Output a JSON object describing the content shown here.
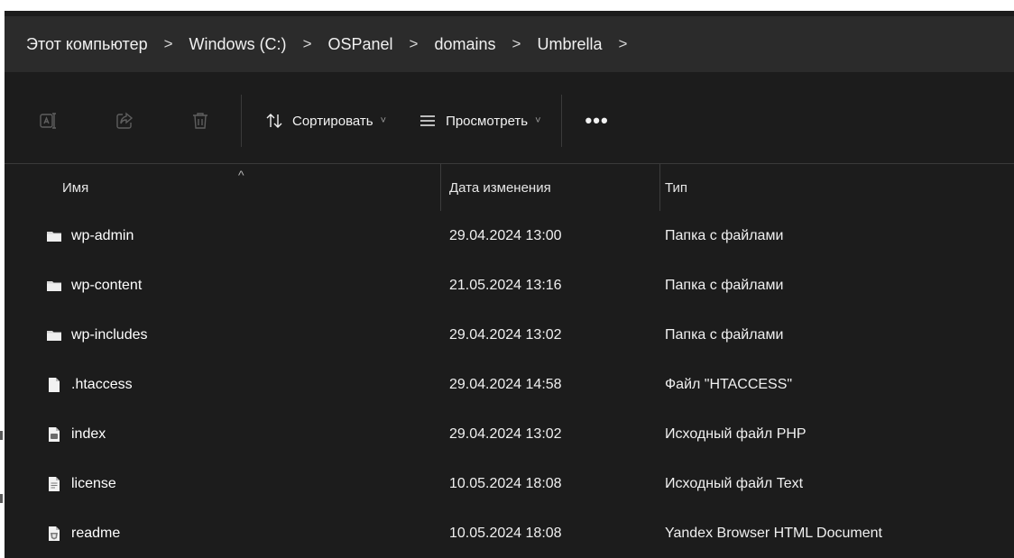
{
  "breadcrumb": [
    {
      "label": "Этот компьютер"
    },
    {
      "label": "Windows (C:)"
    },
    {
      "label": "OSPanel"
    },
    {
      "label": "domains"
    },
    {
      "label": "Umbrella"
    }
  ],
  "breadcrumb_separator": ">",
  "toolbar": {
    "rename_icon": "rename-icon",
    "share_icon": "share-icon",
    "delete_icon": "trash-icon",
    "sort_label": "Сортировать",
    "view_label": "Просмотреть",
    "more_label": "•••",
    "dropdown_chevron": "˅"
  },
  "columns": {
    "name": "Имя",
    "date": "Дата изменения",
    "type": "Тип",
    "sort_indicator": "^"
  },
  "files": [
    {
      "name": "wp-admin",
      "date": "29.04.2024 13:00",
      "type": "Папка с файлами",
      "icon": "folder-icon"
    },
    {
      "name": "wp-content",
      "date": "21.05.2024 13:16",
      "type": "Папка с файлами",
      "icon": "folder-icon"
    },
    {
      "name": "wp-includes",
      "date": "29.04.2024 13:02",
      "type": "Папка с файлами",
      "icon": "folder-icon"
    },
    {
      "name": ".htaccess",
      "date": "29.04.2024 14:58",
      "type": "Файл \"HTACCESS\"",
      "icon": "file-icon"
    },
    {
      "name": "index",
      "date": "29.04.2024 13:02",
      "type": "Исходный файл PHP",
      "icon": "php-file-icon"
    },
    {
      "name": "license",
      "date": "10.05.2024 18:08",
      "type": "Исходный файл Text",
      "icon": "text-file-icon"
    },
    {
      "name": "readme",
      "date": "10.05.2024 18:08",
      "type": "Yandex Browser HTML Document",
      "icon": "html-file-icon"
    }
  ],
  "colors": {
    "background": "#1c1c1c",
    "addressbar": "#2b2b2b",
    "folder": "#dcdcdc",
    "text": "#ffffff"
  }
}
